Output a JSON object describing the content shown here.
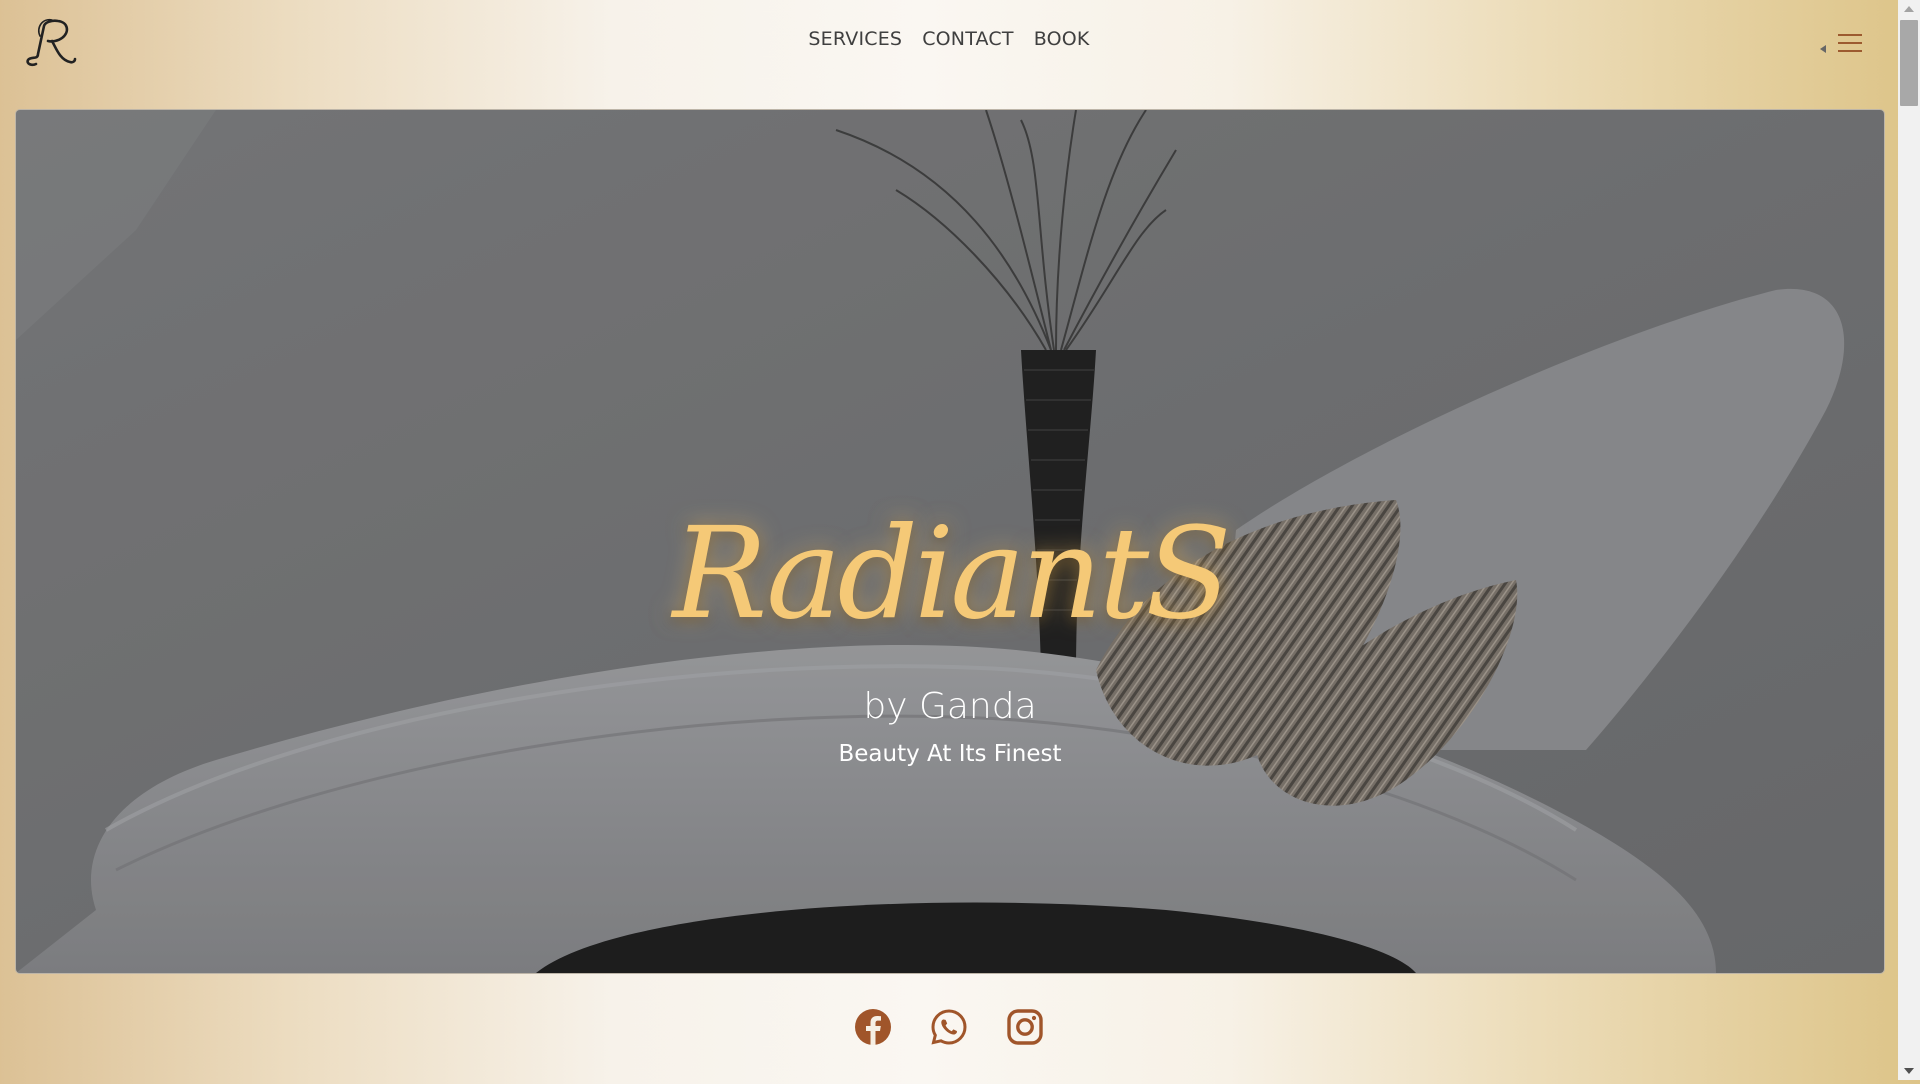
{
  "header": {
    "logo_icon": "monogram-r-logo",
    "nav": [
      {
        "label": "SERVICES"
      },
      {
        "label": "CONTACT"
      },
      {
        "label": "BOOK"
      }
    ],
    "menu_icon": "hamburger-menu-icon"
  },
  "hero": {
    "brand": "RadiantS",
    "byline": "by Ganda",
    "tagline": "Beauty At Its Finest",
    "background_image": "white-lounge-chair-with-striped-pillows-and-vase-photo"
  },
  "social": [
    {
      "icon": "facebook-icon"
    },
    {
      "icon": "whatsapp-icon"
    },
    {
      "icon": "instagram-icon"
    }
  ],
  "colors": {
    "brand_gold": "#f5c977",
    "icon_brown": "#a0552a",
    "nav_text": "#3f3f3f"
  }
}
